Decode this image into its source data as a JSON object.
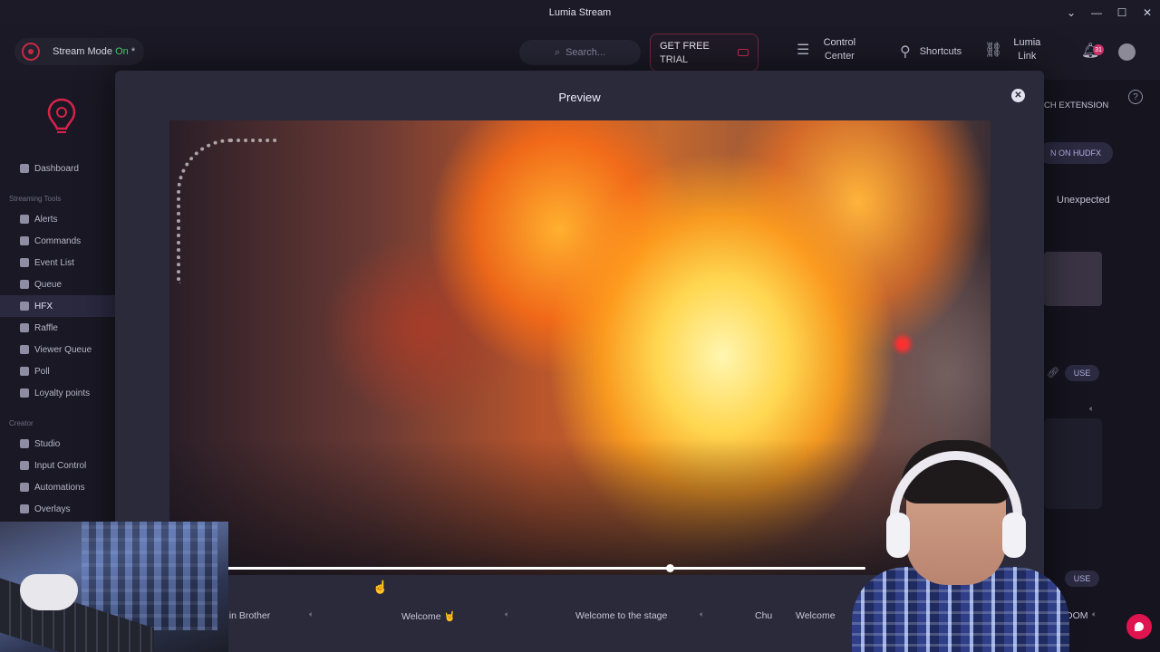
{
  "window": {
    "title": "Lumia Stream",
    "controls": [
      "⌄",
      "—",
      "☐",
      "✕"
    ]
  },
  "header": {
    "stream_mode_label": "Stream Mode",
    "stream_mode_state": "On",
    "stream_mode_suffix": "*",
    "search_placeholder": "Search...",
    "trial_label": "GET FREE TRIAL",
    "control_center": "Control Center",
    "shortcuts": "Shortcuts",
    "lumia_link": "Lumia Link",
    "notification_count": "31"
  },
  "sidebar": {
    "items_top": [
      {
        "label": "Dashboard"
      }
    ],
    "section_streaming": "Streaming Tools",
    "items_streaming": [
      {
        "label": "Alerts"
      },
      {
        "label": "Commands"
      },
      {
        "label": "Event List"
      },
      {
        "label": "Queue"
      },
      {
        "label": "HFX",
        "active": true
      },
      {
        "label": "Raffle"
      },
      {
        "label": "Viewer Queue"
      },
      {
        "label": "Poll"
      },
      {
        "label": "Loyalty points"
      }
    ],
    "section_creator": "Creator",
    "items_creator": [
      {
        "label": "Studio"
      },
      {
        "label": "Input Control"
      },
      {
        "label": "Automations"
      },
      {
        "label": "Overlays"
      }
    ]
  },
  "background_right": {
    "extension_button": "CH EXTENSION",
    "hudfx_button": "N ON HUDFX",
    "unexpected_label": "Unexpected",
    "use_button_1": "USE",
    "use_button_2": "USE",
    "row_item_4_fragment": "DOM"
  },
  "modal": {
    "title": "Preview",
    "close_symbol": "✕",
    "scrub_progress": 0.695
  },
  "under_row": {
    "item1": "e in Brother",
    "item2": "Welcome 🤘",
    "item3": "Welcome to the stage",
    "item4": "Chu",
    "item5": "Welcome"
  },
  "colors": {
    "accent": "#e0144e",
    "active_nav": "#2a2940",
    "modal_bg": "#2a2a3a"
  }
}
